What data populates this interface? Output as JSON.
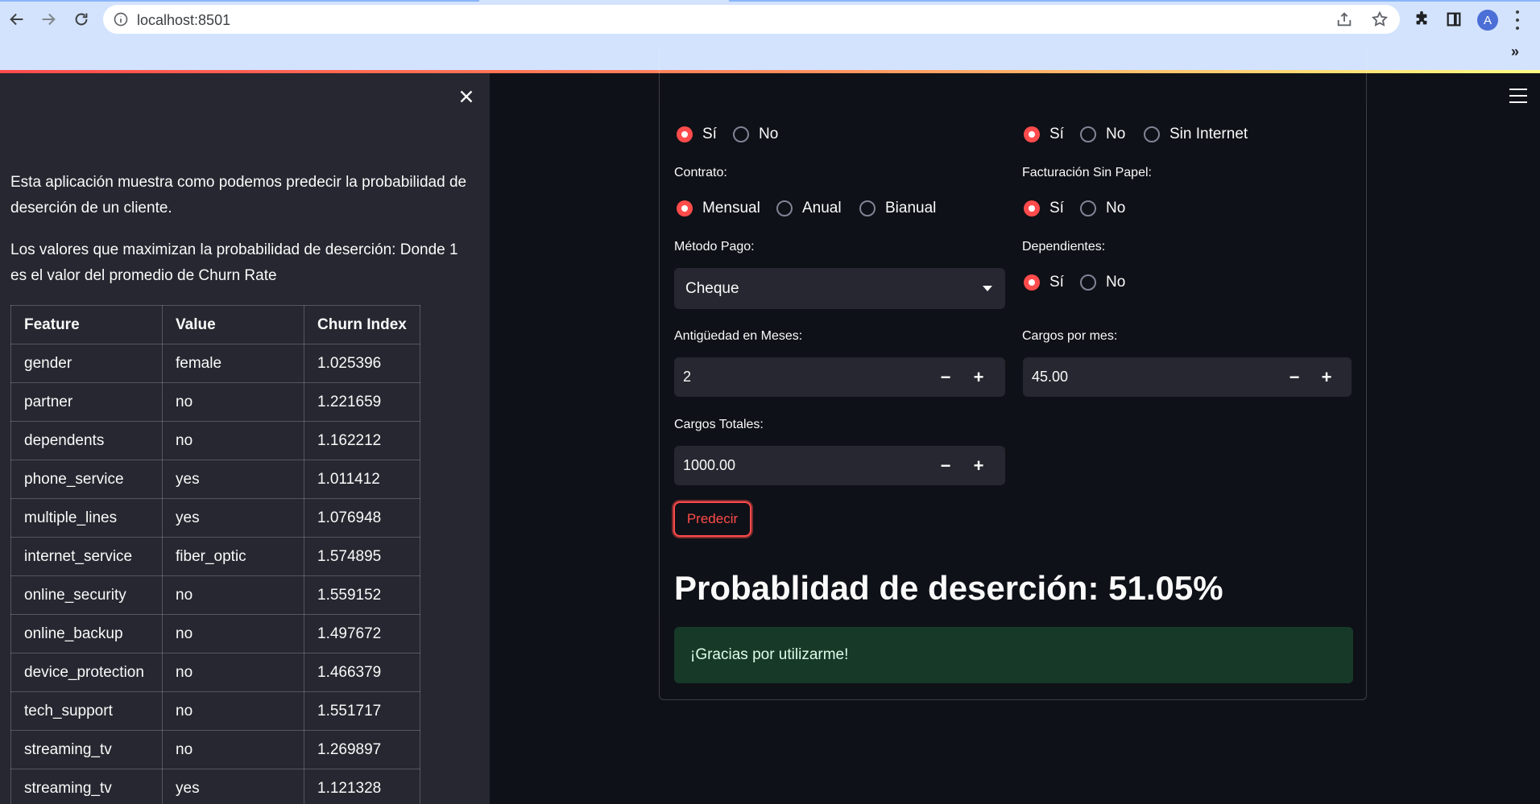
{
  "browser": {
    "url": "localhost:8501",
    "profile_initial": "A",
    "icons": [
      "back-icon",
      "forward-icon",
      "reload-icon",
      "info-icon",
      "share-icon",
      "star-icon",
      "extensions-icon",
      "side-panel-icon",
      "more-icon",
      "chevrons-icon"
    ],
    "more_label": "»"
  },
  "sidebar": {
    "description": "Esta aplicación muestra como podemos predecir la probabilidad de deserción de un cliente.",
    "explanation": "Los valores que maximizan la probabilidad de deserción: Donde 1 es el valor del promedio de Churn Rate",
    "table": {
      "headers": [
        "Feature",
        "Value",
        "Churn Index"
      ],
      "rows": [
        [
          "gender",
          "female",
          "1.025396"
        ],
        [
          "partner",
          "no",
          "1.221659"
        ],
        [
          "dependents",
          "no",
          "1.162212"
        ],
        [
          "phone_service",
          "yes",
          "1.011412"
        ],
        [
          "multiple_lines",
          "yes",
          "1.076948"
        ],
        [
          "internet_service",
          "fiber_optic",
          "1.574895"
        ],
        [
          "online_security",
          "no",
          "1.559152"
        ],
        [
          "online_backup",
          "no",
          "1.497672"
        ],
        [
          "device_protection",
          "no",
          "1.466379"
        ],
        [
          "tech_support",
          "no",
          "1.551717"
        ],
        [
          "streaming_tv",
          "no",
          "1.269897"
        ],
        [
          "streaming_tv",
          "yes",
          "1.121328"
        ]
      ]
    }
  },
  "form": {
    "top_left_radio": {
      "options": [
        "Sí",
        "No"
      ],
      "selected": "Sí"
    },
    "top_right_radio": {
      "options": [
        "Sí",
        "No",
        "Sin Internet"
      ],
      "selected": "Sí"
    },
    "contrato": {
      "label": "Contrato:",
      "options": [
        "Mensual",
        "Anual",
        "Bianual"
      ],
      "selected": "Mensual"
    },
    "facturacion": {
      "label": "Facturación Sin Papel:",
      "options": [
        "Sí",
        "No"
      ],
      "selected": "Sí"
    },
    "metodo_pago": {
      "label": "Método Pago:",
      "value": "Cheque"
    },
    "dependientes": {
      "label": "Dependientes:",
      "options": [
        "Sí",
        "No"
      ],
      "selected": "Sí"
    },
    "antiguedad": {
      "label": "Antigüedad en Meses:",
      "value": "2"
    },
    "cargos_mes": {
      "label": "Cargos por mes:",
      "value": "45.00"
    },
    "cargos_totales": {
      "label": "Cargos Totales:",
      "value": "1000.00"
    },
    "stepper": {
      "minus": "−",
      "plus": "+"
    },
    "predict_label": "Predecir"
  },
  "result": {
    "text": "Probablidad de deserción: 51.05%",
    "probability_percent": 51.05,
    "success_message": "¡Gracias por utilizarme!"
  },
  "colors": {
    "primary": "#ff4b4b",
    "background": "#0e1117",
    "sidebar_bg": "#262730",
    "success_bg": "#173928"
  }
}
